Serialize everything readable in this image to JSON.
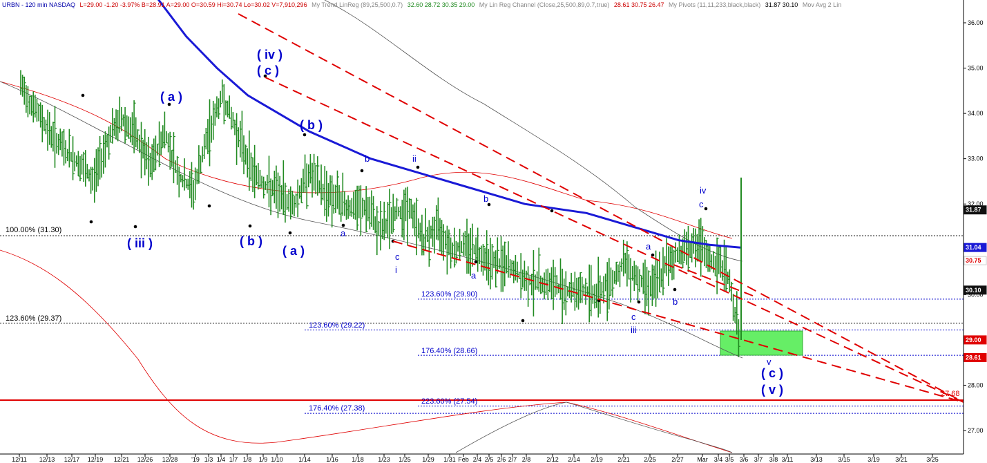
{
  "header": {
    "symbol": "URBN - 120 min  NASDAQ",
    "stats": "L=29.00  -1.20  -3.97%  B=28.91  A=29.00  O=30.59  Hi=30.74  Lo=30.02  V=7,910,296",
    "study1_name": "My  Trend  LinReg (89,25,500,0.7)",
    "study1_vals": "32.60  28.72  30.35  29.00",
    "study2_name": "My Lin Reg Channel (Close,25,500,89,0.7,true)",
    "study2_vals": "28.61  30.75  26.47",
    "study3_name": "My  Pivots (11,11,233,black,black)",
    "study3_vals": "31.87  30.10",
    "study4_name": "Mov Avg 2 Lin"
  },
  "colors": {
    "price_bars": "#228b22",
    "ma_blue": "#1a1ad6",
    "red": "#e00000",
    "channel_black": "#555555",
    "fib_blue": "#0000cc",
    "target_box": "#66ee66"
  },
  "chart_data": {
    "type": "line",
    "title": "URBN - 120 min NASDAQ",
    "ylim": [
      26.6,
      36.3
    ],
    "y_ticks": [
      "36.00",
      "35.00",
      "34.00",
      "33.00",
      "32.00",
      "31.00",
      "30.00",
      "29.00",
      "28.00",
      "27.00"
    ],
    "x_ticks": [
      "12/11",
      "12/13",
      "12/17",
      "12/19",
      "12/21",
      "12/26",
      "12/28",
      "'19",
      "1/3",
      "1/4",
      "1/7",
      "1/8",
      "1/9",
      "1/10",
      "1/14",
      "1/16",
      "1/18",
      "1/23",
      "1/25",
      "1/29",
      "1/31",
      "Feb",
      "2/4",
      "2/5",
      "2/6",
      "2/7",
      "2/8",
      "2/12",
      "2/14",
      "2/19",
      "2/21",
      "2/25",
      "2/27",
      "Mar",
      "3/4",
      "3/5",
      "3/6",
      "3/7",
      "3/8",
      "3/11",
      "3/13",
      "3/15",
      "3/19",
      "3/21",
      "3/25"
    ],
    "price_tags": [
      {
        "label": "31.87",
        "value": 31.87,
        "bg": "#111111",
        "fg": "#ffffff"
      },
      {
        "label": "31.04",
        "value": 31.04,
        "bg": "#1a1ad6",
        "fg": "#ffffff"
      },
      {
        "label": "30.75",
        "value": 30.75,
        "bg": "#ffffff",
        "fg": "#e00000"
      },
      {
        "label": "30.10",
        "value": 30.1,
        "bg": "#111111",
        "fg": "#ffffff"
      },
      {
        "label": "29.00",
        "value": 29.0,
        "bg": "#e00000",
        "fg": "#ffffff"
      },
      {
        "label": "28.61",
        "value": 28.61,
        "bg": "#e00000",
        "fg": "#ffffff"
      }
    ],
    "fib_levels": [
      {
        "label": "100.00% (31.30)",
        "value": 31.3,
        "color": "#000000"
      },
      {
        "label": "123.60% (29.37)",
        "value": 29.37,
        "color": "#000000"
      },
      {
        "label": "123.60% (29.90)",
        "value": 29.9,
        "color": "#0000cc"
      },
      {
        "label": "123.60% (29.22)",
        "value": 29.22,
        "color": "#0000cc"
      },
      {
        "label": "176.40% (28.66)",
        "value": 28.66,
        "color": "#0000cc"
      },
      {
        "label": "223.60% (27.54)",
        "value": 27.54,
        "color": "#0000cc"
      },
      {
        "label": "176.40% (27.38)",
        "value": 27.38,
        "color": "#0000cc"
      }
    ],
    "horizontal_line_label": "27.68",
    "wave_labels_big": [
      "( iv )",
      "( c )",
      "( a )",
      "( b )",
      "( iii )",
      "( b )",
      "( a )",
      "( c )",
      "( v )"
    ],
    "wave_labels_small": [
      "b",
      "ii",
      "b",
      "a",
      "c",
      "i",
      "a",
      "a",
      "b",
      "c",
      "iii",
      "iv",
      "c",
      "v"
    ],
    "series": [
      {
        "name": "Price",
        "values": [
          34.6,
          34.1,
          33.6,
          33.2,
          32.9,
          32.5,
          33.4,
          33.9,
          33.5,
          32.8,
          33.6,
          32.6,
          32.3,
          33.5,
          34.4,
          33.6,
          32.8,
          32.4,
          32.2,
          32.0,
          32.7,
          32.3,
          32.1,
          31.9,
          31.9,
          31.4,
          31.8,
          31.9,
          31.2,
          31.5,
          31.0,
          31.1,
          30.9,
          30.7,
          30.6,
          30.3,
          30.3,
          30.2,
          30.1,
          30.1,
          30.0,
          30.3,
          30.7,
          30.3,
          30.2,
          30.7,
          31.0,
          31.1,
          30.7,
          30.6,
          29.0
        ]
      },
      {
        "name": "Moving average",
        "values": [
          36.6,
          35.7,
          35.0,
          34.4,
          34.0,
          33.6,
          33.3,
          33.0,
          32.8,
          32.6,
          32.4,
          32.2,
          32.0,
          31.9,
          31.8,
          31.6,
          31.4,
          31.2,
          31.1,
          31.04
        ]
      }
    ]
  }
}
